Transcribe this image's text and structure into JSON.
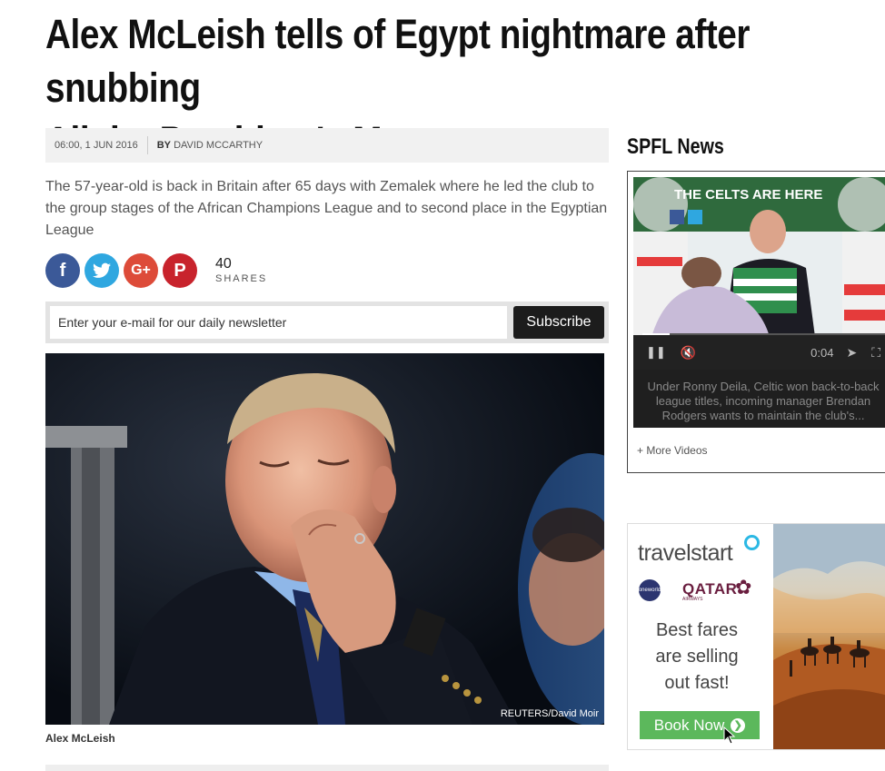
{
  "article": {
    "headline_line1": "Alex McLeish tells of Egypt nightmare after snubbing",
    "headline_line2": "All the President's Men",
    "date": "06:00, 1 JUN 2016",
    "by_prefix": "BY",
    "author": "DAVID MCCARTHY",
    "standfirst": "The 57-year-old is back in Britain after 65 days with Zemalek where he led the club to the group stages of the African Champions League and to second place in the Egyptian League",
    "photo_credit": "REUTERS/David Moir",
    "caption": "Alex McLeish"
  },
  "share": {
    "count": "40",
    "label": "SHARES",
    "buttons": [
      {
        "name": "facebook",
        "glyph": "f"
      },
      {
        "name": "twitter",
        "glyph": "t"
      },
      {
        "name": "google-plus",
        "glyph": "G+"
      },
      {
        "name": "pinterest",
        "glyph": "P"
      }
    ]
  },
  "newsletter": {
    "placeholder": "Enter your e-mail for our daily newsletter",
    "subscribe_label": "Subscribe"
  },
  "sidebar": {
    "section_title": "SPFL News",
    "video": {
      "banner_text": "THE CELTS ARE HERE",
      "time": "0:04",
      "description": "Under Ronny Deila, Celtic won back-to-back league titles, incoming manager Brendan Rodgers wants to maintain the club's...",
      "progress": 0.11
    },
    "more_videos": "+ More Videos"
  },
  "ad": {
    "brand": "travelstart",
    "partner": "QATAR",
    "partner_sub": "AIRWAYS",
    "oneworld": "oneworld",
    "copy_line1": "Best fares",
    "copy_line2": "are selling",
    "copy_line3": "out fast!",
    "cta": "Book Now"
  },
  "colors": {
    "facebook": "#3b5998",
    "twitter": "#2fa7e0",
    "google_plus": "#dd4b39",
    "pinterest": "#c8232c",
    "cta_green": "#5cb85c"
  }
}
